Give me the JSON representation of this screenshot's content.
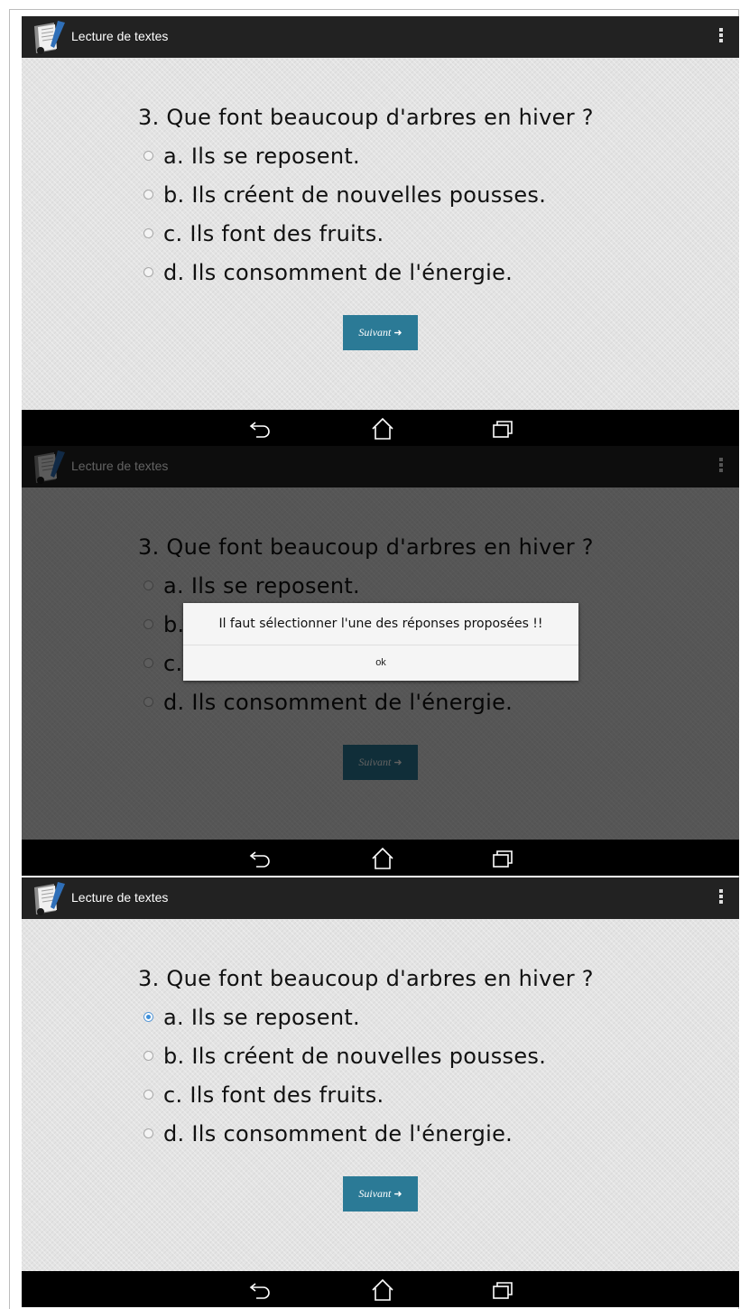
{
  "app": {
    "title": "Lecture de textes",
    "icon": "notebook-pen-icon",
    "menu_icon": "overflow-menu-icon"
  },
  "quiz": {
    "question": "3. Que font beaucoup d'arbres en hiver ?",
    "options": [
      {
        "label": "a. Ils se reposent."
      },
      {
        "label": "b. Ils créent de nouvelles pousses."
      },
      {
        "label": "c. Ils font des fruits."
      },
      {
        "label": "d. Ils consomment de l'énergie."
      }
    ],
    "next_label": "Suivant",
    "next_icon": "arrow-right-icon"
  },
  "screens": [
    {
      "state": "no-selection",
      "selected_option": null,
      "dialog_visible": false
    },
    {
      "state": "alert-shown",
      "selected_option": null,
      "dialog_visible": true
    },
    {
      "state": "option-a-selected",
      "selected_option": "a",
      "dialog_visible": false
    }
  ],
  "dialog": {
    "message": "Il faut sélectionner l'une des réponses proposées !!",
    "ok_label": "ok"
  },
  "navbar": {
    "buttons": [
      "back-icon",
      "home-icon",
      "recent-apps-icon"
    ]
  },
  "colors": {
    "action_bar": "#222222",
    "content_bg": "#e3e3e3",
    "button_bg": "#2b7a96",
    "radio_selected": "#3d8fd9",
    "navbar": "#000000"
  }
}
